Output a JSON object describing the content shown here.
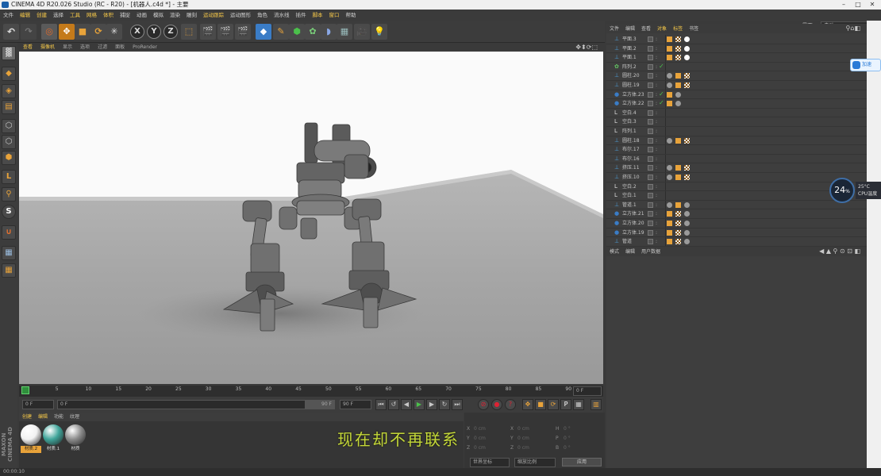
{
  "titlebar": {
    "title": "CINEMA 4D R20.026 Studio (RC - R20) - [机器人.c4d *] - 主要"
  },
  "menu": [
    "文件",
    "编辑",
    "创建",
    "选择",
    "工具",
    "网格",
    "体积",
    "捕捉",
    "动画",
    "模拟",
    "渲染",
    "雕刻",
    "运动跟踪",
    "运动图形",
    "角色",
    "流水线",
    "插件",
    "脚本",
    "窗口",
    "帮助"
  ],
  "interface": {
    "label": "界面:",
    "value": "启动"
  },
  "toolbar": {
    "axis_x": "X",
    "axis_y": "Y",
    "axis_z": "Z"
  },
  "viewport_menu": [
    "查看",
    "摄像机",
    "显示",
    "选项",
    "过滤",
    "面板",
    "ProRender"
  ],
  "timeline": {
    "ticks": [
      "0",
      "5",
      "10",
      "15",
      "20",
      "25",
      "30",
      "35",
      "40",
      "45",
      "50",
      "55",
      "60",
      "65",
      "70",
      "75",
      "80",
      "85",
      "90"
    ],
    "current_frame": "0 F",
    "start_field": "0 F",
    "mid_field": "0 F",
    "end_field_a": "90 F",
    "end_field_b": "90 F"
  },
  "material_menu": [
    "创建",
    "编辑",
    "功能",
    "纹理"
  ],
  "materials": [
    {
      "label": "材质.2",
      "color": "#f2f2f2"
    },
    {
      "label": "材质.1",
      "color": "#3fa59a"
    },
    {
      "label": "材质",
      "color": "#8c8c8c"
    }
  ],
  "subtitle": "现在却不再联系",
  "coords": {
    "row_labels_a": [
      "X",
      "Y",
      "Z"
    ],
    "row_labels_b": [
      "X",
      "Y",
      "Z"
    ],
    "row_labels_c": [
      "H",
      "P",
      "B"
    ],
    "pos": [
      "0 cm",
      "0 cm",
      "0 cm"
    ],
    "size": [
      "0 cm",
      "0 cm",
      "0 cm"
    ],
    "rot": [
      "0 °",
      "0 °",
      "0 °"
    ],
    "world_label": "世界坐标",
    "scale_label": "缩放比例",
    "apply": "应用"
  },
  "statusbar": "00:00:10",
  "maxon": "MAXON CINEMA 4D",
  "object_manager": {
    "menu": [
      "文件",
      "编辑",
      "查看",
      "对象",
      "标签",
      "书签"
    ],
    "rows": [
      {
        "name": "平面.3",
        "icon": "plane-icon",
        "tags": [
          "orange",
          "checker",
          "white"
        ],
        "check": false
      },
      {
        "name": "平面.2",
        "icon": "plane-icon",
        "tags": [
          "orange",
          "checker",
          "white"
        ],
        "check": false
      },
      {
        "name": "平面.1",
        "icon": "plane-icon",
        "tags": [
          "orange",
          "checker",
          "white"
        ],
        "check": false
      },
      {
        "name": "阵列.2",
        "icon": "array-icon",
        "tags": [],
        "check": true
      },
      {
        "name": "圆柱.20",
        "icon": "cylinder-icon",
        "tags": [
          "grey",
          "orange",
          "checker"
        ],
        "check": false
      },
      {
        "name": "圆柱.19",
        "icon": "cylinder-icon",
        "tags": [
          "grey",
          "orange",
          "checker"
        ],
        "check": false
      },
      {
        "name": "立方体.23",
        "icon": "cube-icon",
        "tags": [
          "orange",
          "grey"
        ],
        "check": true
      },
      {
        "name": "立方体.22",
        "icon": "cube-icon",
        "tags": [
          "orange",
          "grey"
        ],
        "check": true
      },
      {
        "name": "空白.4",
        "icon": "null-icon",
        "tags": [],
        "check": false
      },
      {
        "name": "空白.3",
        "icon": "null-icon",
        "tags": [],
        "check": false
      },
      {
        "name": "阵列.1",
        "icon": "null-icon",
        "tags": [],
        "check": false
      },
      {
        "name": "圆柱.18",
        "icon": "cylinder-icon",
        "tags": [
          "grey",
          "orange",
          "checker"
        ],
        "check": false
      },
      {
        "name": "布尔.17",
        "icon": "boole-icon",
        "tags": [],
        "check": false
      },
      {
        "name": "布尔.16",
        "icon": "boole-icon",
        "tags": [],
        "check": false
      },
      {
        "name": "挤压.11",
        "icon": "extrude-icon",
        "tags": [
          "grey",
          "orange",
          "checker"
        ],
        "check": false
      },
      {
        "name": "挤压.10",
        "icon": "extrude-icon",
        "tags": [
          "grey",
          "orange",
          "checker"
        ],
        "check": false
      },
      {
        "name": "空白.2",
        "icon": "null-icon",
        "tags": [],
        "check": false
      },
      {
        "name": "空白.1",
        "icon": "null-icon",
        "tags": [],
        "check": false
      },
      {
        "name": "管道.1",
        "icon": "tube-icon",
        "tags": [
          "grey",
          "orange",
          "grey"
        ],
        "check": false
      },
      {
        "name": "立方体.21",
        "icon": "cube-icon",
        "tags": [
          "orange",
          "checker",
          "grey"
        ],
        "check": false
      },
      {
        "name": "立方体.20",
        "icon": "cube-icon",
        "tags": [
          "orange",
          "checker",
          "grey"
        ],
        "check": false
      },
      {
        "name": "立方体.19",
        "icon": "cube-icon",
        "tags": [
          "orange",
          "checker",
          "grey"
        ],
        "check": false
      },
      {
        "name": "管道",
        "icon": "tube-icon",
        "tags": [
          "orange",
          "checker",
          "grey"
        ],
        "check": false
      }
    ]
  },
  "attribute_manager": {
    "menu": [
      "模式",
      "编辑",
      "用户数据"
    ]
  },
  "overlay": {
    "cpu_percent": "24",
    "cpu_unit": "%",
    "temp": "25°C",
    "temp_label": "CPU温度",
    "cloud": "加速"
  }
}
